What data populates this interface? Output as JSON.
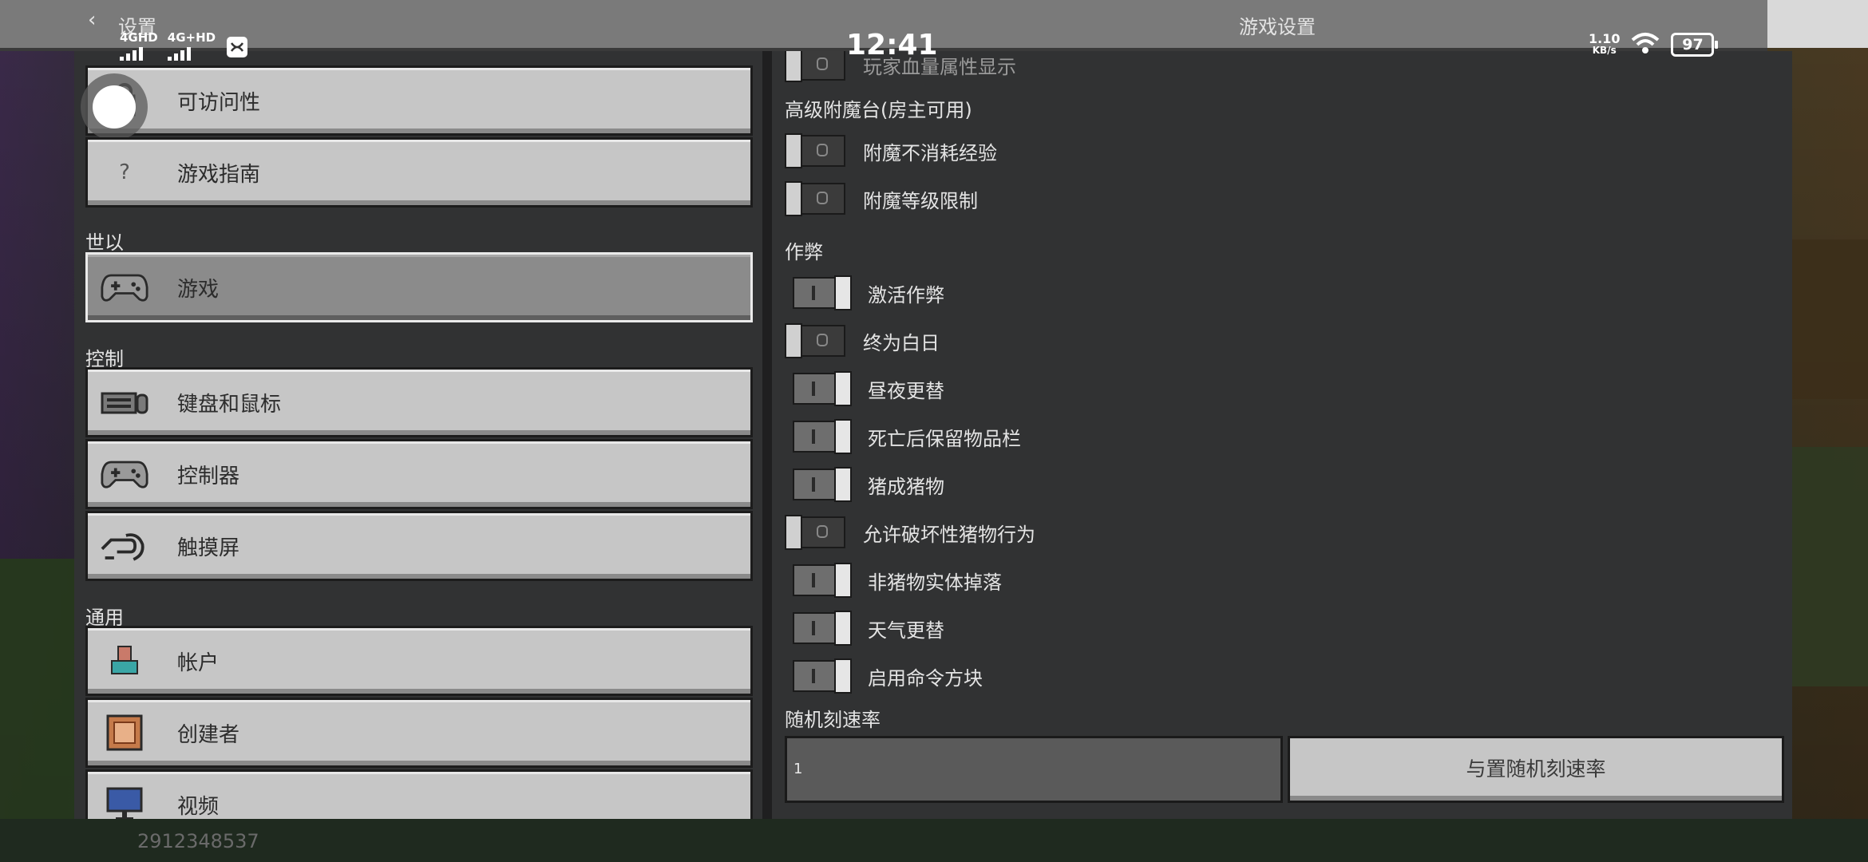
{
  "status_bar": {
    "network1": "4GHD",
    "network2": "4G+HD",
    "time": "12:41",
    "speed_value": "1.10",
    "speed_unit": "KB/s",
    "battery": "97"
  },
  "header": {
    "back_label": "设置",
    "title": "游戏设置"
  },
  "sidebar": {
    "top_items": [
      {
        "label": "可访问性",
        "icon": "lock-icon"
      },
      {
        "label": "游戏指南",
        "icon": "question-icon"
      }
    ],
    "sections": [
      {
        "title": "世以",
        "items": [
          {
            "label": "游戏",
            "icon": "gamepad-icon",
            "active": true
          }
        ]
      },
      {
        "title": "控制",
        "items": [
          {
            "label": "键盘和鼠标",
            "icon": "keyboard-mouse-icon"
          },
          {
            "label": "控制器",
            "icon": "controller-icon"
          },
          {
            "label": "触摸屏",
            "icon": "touch-icon"
          }
        ]
      },
      {
        "title": "通用",
        "items": [
          {
            "label": "帐户",
            "icon": "account-icon"
          },
          {
            "label": "创建者",
            "icon": "creator-icon"
          },
          {
            "label": "视频",
            "icon": "video-icon"
          }
        ]
      }
    ]
  },
  "settings": {
    "partial_top": {
      "label": "玩家血量属性显示",
      "on": false
    },
    "enchant_title": "高级附魔台(房主可用)",
    "enchant_items": [
      {
        "label": "附魔不消耗经验",
        "on": false
      },
      {
        "label": "附魔等级限制",
        "on": false
      }
    ],
    "cheats_title": "作弊",
    "cheat_items": [
      {
        "label": "激活作弊",
        "on": true
      },
      {
        "label": "终为白日",
        "on": false
      },
      {
        "label": "昼夜更替",
        "on": true
      },
      {
        "label": "死亡后保留物品栏",
        "on": true
      },
      {
        "label": "猪成猪物",
        "on": true
      },
      {
        "label": "允许破坏性猪物行为",
        "on": false
      },
      {
        "label": "非猪物实体掉落",
        "on": true
      },
      {
        "label": "天气更替",
        "on": true
      },
      {
        "label": "启用命令方块",
        "on": true
      }
    ],
    "tick_title": "随机刻速率",
    "tick_value": "1",
    "tick_preset_label": "与置随机刻速率"
  },
  "watermark": "2912348537"
}
